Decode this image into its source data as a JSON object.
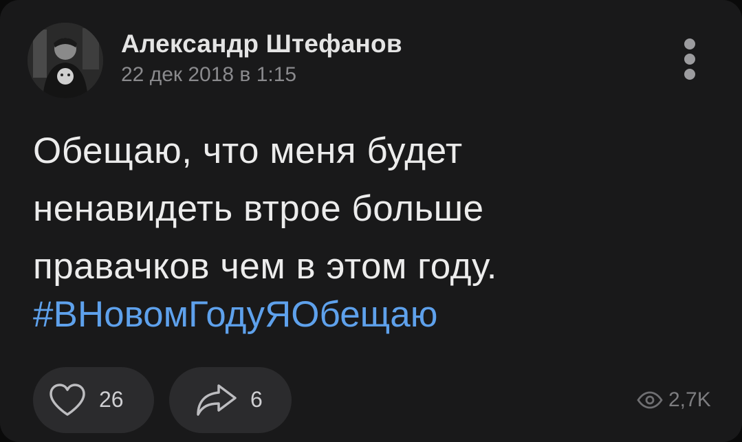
{
  "post": {
    "author": "Александр Штефанов",
    "date": "22 дек 2018 в 1:15",
    "text_lines": [
      "Обещаю, что меня будет",
      "ненавидеть втрое больше",
      "правачков чем в этом году."
    ],
    "hashtag": "#ВНовомГодуЯОбещаю"
  },
  "actions": {
    "likes": "26",
    "shares": "6",
    "views": "2,7K"
  },
  "colors": {
    "background": "#19191a",
    "text": "#ececec",
    "secondary": "#8a8a8d",
    "hashtag": "#5ea1ec",
    "pill": "#2b2b2d"
  },
  "icons": {
    "avatar": "author-avatar",
    "more": "more-vertical-icon",
    "like": "heart-icon",
    "share": "share-arrow-icon",
    "views": "eye-icon"
  }
}
